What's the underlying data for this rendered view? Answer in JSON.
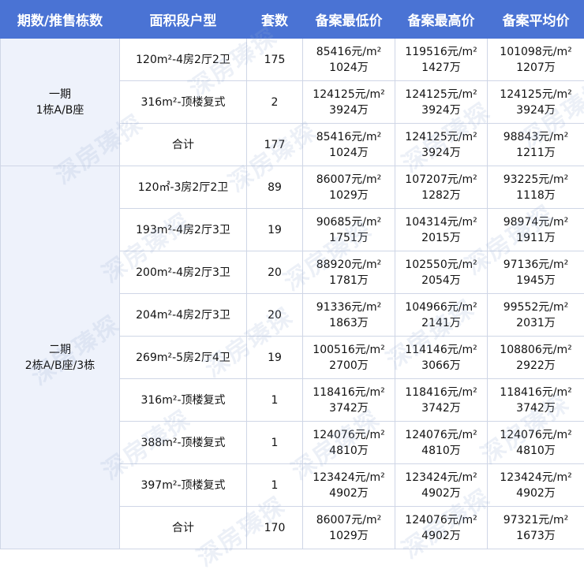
{
  "headers": [
    "期数/推售栋数",
    "面积段户型",
    "套数",
    "备案最低价",
    "备案最高价",
    "备案平均价"
  ],
  "phase1": {
    "name_line1": "一期",
    "name_line2": "1栋A/B座",
    "rows": [
      {
        "type": "120m²-4房2厅2卫",
        "count": "175",
        "min_unit": "85416元/m²",
        "min_total": "1024万",
        "max_unit": "119516元/m²",
        "max_total": "1427万",
        "avg_unit": "101098元/m²",
        "avg_total": "1207万"
      },
      {
        "type": "316m²-顶楼复式",
        "count": "2",
        "min_unit": "124125元/m²",
        "min_total": "3924万",
        "max_unit": "124125元/m²",
        "max_total": "3924万",
        "avg_unit": "124125元/m²",
        "avg_total": "3924万"
      },
      {
        "type": "合计",
        "count": "177",
        "min_unit": "85416元/m²",
        "min_total": "1024万",
        "max_unit": "124125元/m²",
        "max_total": "3924万",
        "avg_unit": "98843元/m²",
        "avg_total": "1211万"
      }
    ]
  },
  "phase2": {
    "name_line1": "二期",
    "name_line2": "2栋A/B座/3栋",
    "rows": [
      {
        "type": "120㎡-3房2厅2卫",
        "count": "89",
        "min_unit": "86007元/m²",
        "min_total": "1029万",
        "max_unit": "107207元/m²",
        "max_total": "1282万",
        "avg_unit": "93225元/m²",
        "avg_total": "1118万"
      },
      {
        "type": "193m²-4房2厅3卫",
        "count": "19",
        "min_unit": "90685元/m²",
        "min_total": "1751万",
        "max_unit": "104314元/m²",
        "max_total": "2015万",
        "avg_unit": "98974元/m²",
        "avg_total": "1911万"
      },
      {
        "type": "200m²-4房2厅3卫",
        "count": "20",
        "min_unit": "88920元/m²",
        "min_total": "1781万",
        "max_unit": "102550元/m²",
        "max_total": "2054万",
        "avg_unit": "97136元/m²",
        "avg_total": "1945万"
      },
      {
        "type": "204m²-4房2厅3卫",
        "count": "20",
        "min_unit": "91336元/m²",
        "min_total": "1863万",
        "max_unit": "104966元/m²",
        "max_total": "2141万",
        "avg_unit": "99552元/m²",
        "avg_total": "2031万"
      },
      {
        "type": "269m²-5房2厅4卫",
        "count": "19",
        "min_unit": "100516元/m²",
        "min_total": "2700万",
        "max_unit": "114146元/m²",
        "max_total": "3066万",
        "avg_unit": "108806元/m²",
        "avg_total": "2922万"
      },
      {
        "type": "316m²-顶楼复式",
        "count": "1",
        "min_unit": "118416元/m²",
        "min_total": "3742万",
        "max_unit": "118416元/m²",
        "max_total": "3742万",
        "avg_unit": "118416元/m²",
        "avg_total": "3742万"
      },
      {
        "type": "388m²-顶楼复式",
        "count": "1",
        "min_unit": "124076元/m²",
        "min_total": "4810万",
        "max_unit": "124076元/m²",
        "max_total": "4810万",
        "avg_unit": "124076元/m²",
        "avg_total": "4810万"
      },
      {
        "type": "397m²-顶楼复式",
        "count": "1",
        "min_unit": "123424元/m²",
        "min_total": "4902万",
        "max_unit": "123424元/m²",
        "max_total": "4902万",
        "avg_unit": "123424元/m²",
        "avg_total": "4902万"
      },
      {
        "type": "合计",
        "count": "170",
        "min_unit": "86007元/m²",
        "min_total": "1029万",
        "max_unit": "124076元/m²",
        "max_total": "4902万",
        "avg_unit": "97321元/m²",
        "avg_total": "1673万"
      }
    ]
  },
  "watermark": "深房瑧探",
  "colors": {
    "header_bg": "#4a73d4",
    "section_bg": "#eef2fb",
    "border": "#cfd6e6"
  }
}
